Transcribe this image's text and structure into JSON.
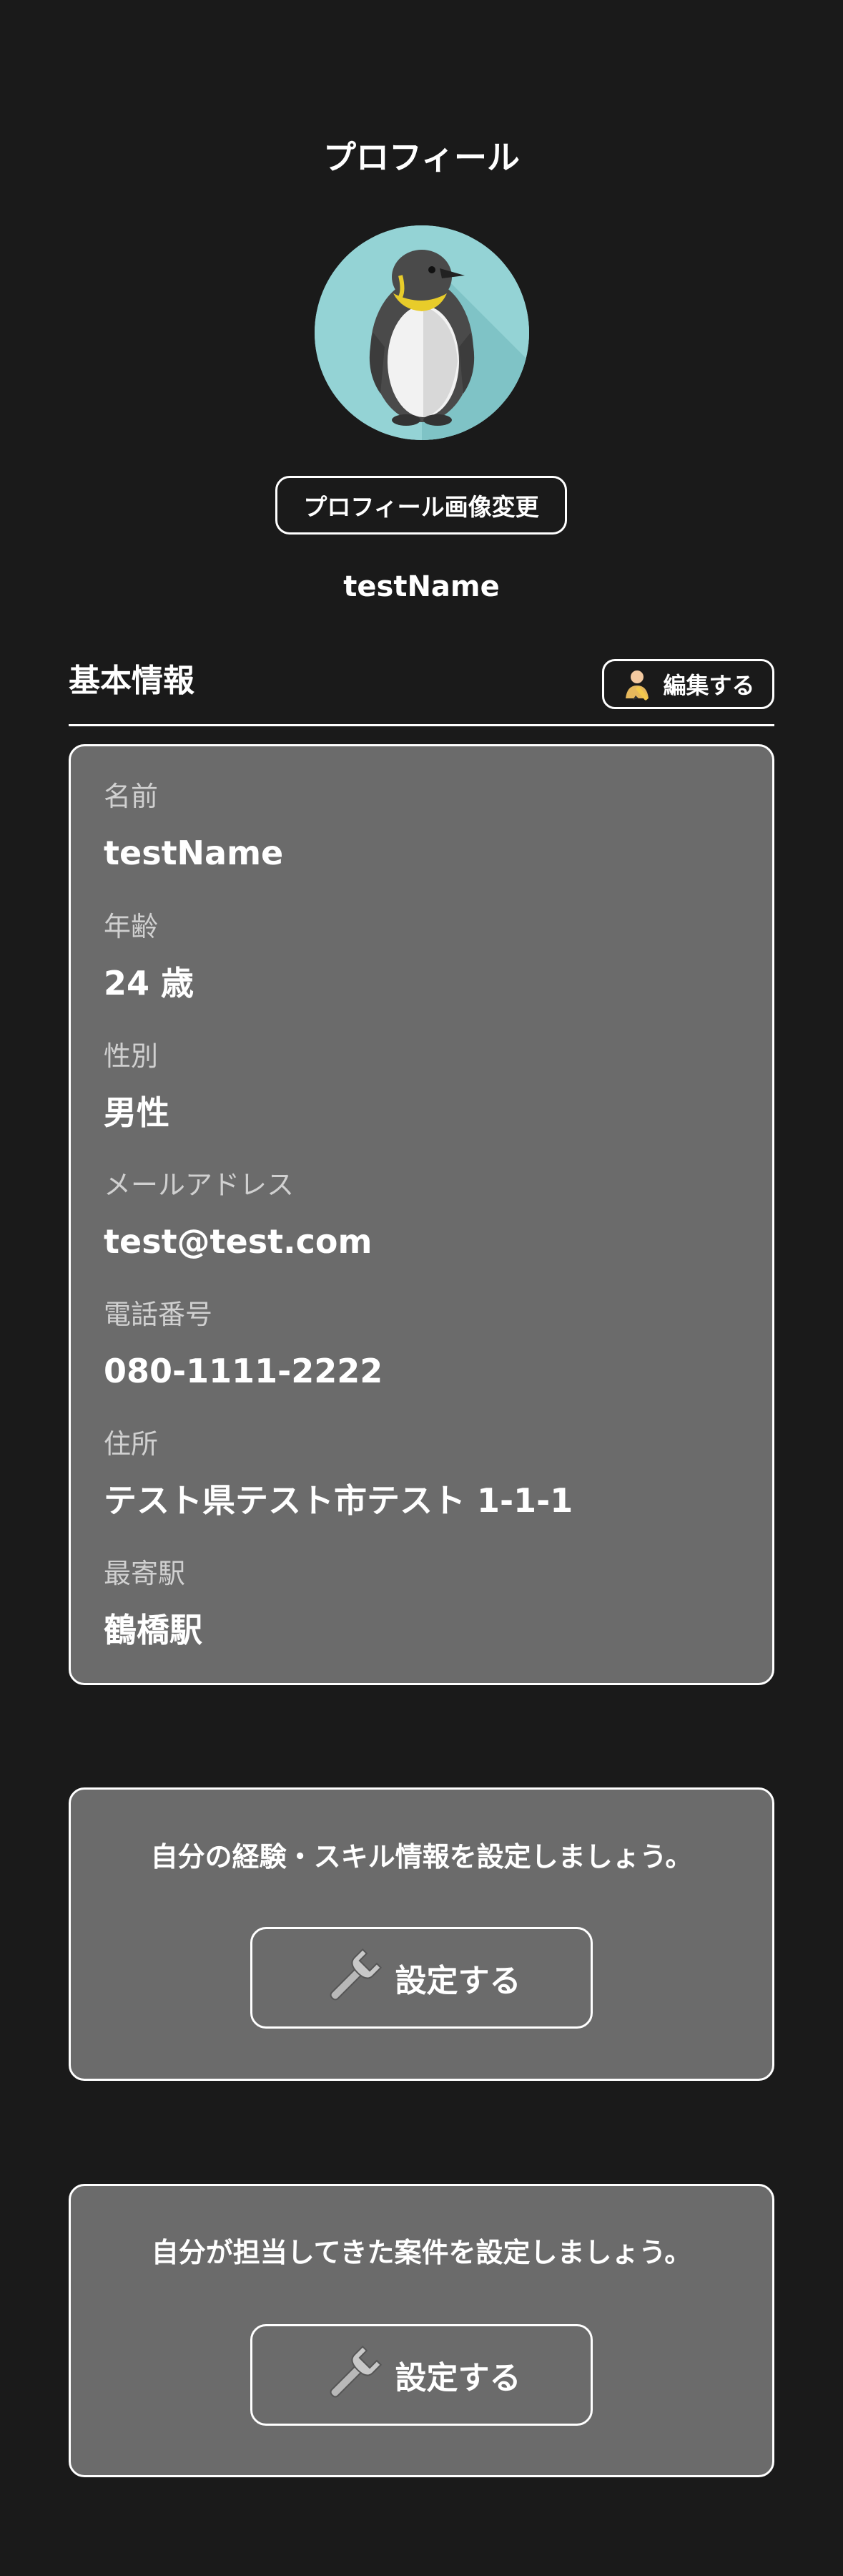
{
  "header": {
    "title": "プロフィール"
  },
  "profile": {
    "avatar_icon": "penguin-avatar-icon",
    "change_image_label": "プロフィール画像変更",
    "username": "testName"
  },
  "basic_info": {
    "title": "基本情報",
    "edit_label": "編集する",
    "edit_icon": "person-edit-icon",
    "fields": [
      {
        "label": "名前",
        "value": "testName"
      },
      {
        "label": "年齢",
        "value": "24 歳"
      },
      {
        "label": "性別",
        "value": "男性"
      },
      {
        "label": "メールアドレス",
        "value": "test@test.com"
      },
      {
        "label": "電話番号",
        "value": "080-1111-2222"
      },
      {
        "label": "住所",
        "value": "テスト県テスト市テスト 1-1-1"
      },
      {
        "label": "最寄駅",
        "value": "鶴橋駅"
      }
    ]
  },
  "skills": {
    "message": "自分の経験・スキル情報を設定しましょう。",
    "button_label": "設定する",
    "button_icon": "wrench-icon"
  },
  "projects": {
    "message": "自分が担当してきた案件を設定しましょう。",
    "button_label": "設定する",
    "button_icon": "wrench-icon"
  },
  "colors": {
    "background": "#1a1a1a",
    "card": "#6b6b6b",
    "border": "#ffffff",
    "avatar_bg": "#94d3d5"
  }
}
